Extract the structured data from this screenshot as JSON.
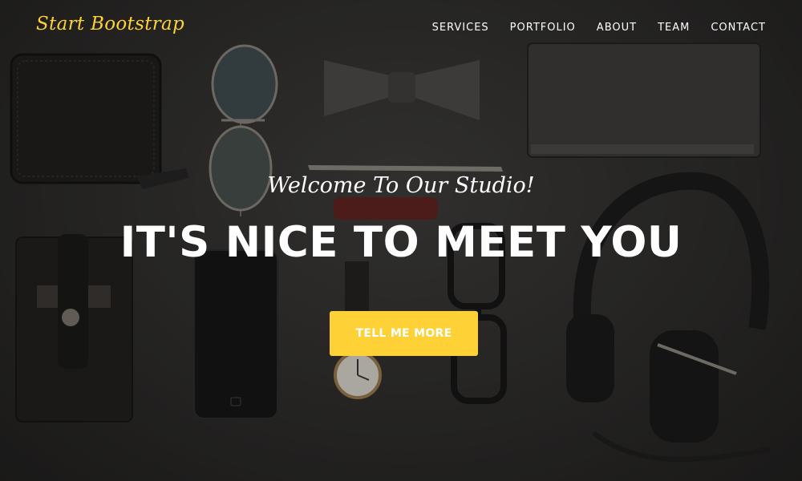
{
  "navbar": {
    "brand": "Start Bootstrap",
    "links": [
      "SERVICES",
      "PORTFOLIO",
      "ABOUT",
      "TEAM",
      "CONTACT"
    ]
  },
  "hero": {
    "lead_in": "Welcome To Our Studio!",
    "heading": "IT'S NICE TO MEET YOU",
    "cta_label": "TELL ME MORE"
  },
  "colors": {
    "accent": "#fed136",
    "text": "#ffffff",
    "background": "#2b2a29"
  },
  "background_image": {
    "objects": [
      "wallet-image",
      "sunglasses-image",
      "bow-tie-image",
      "notebook-image",
      "pen-image",
      "phone-case-image",
      "smartphone-image",
      "wristwatch-image",
      "eyeglasses-image",
      "headphones-image"
    ]
  }
}
